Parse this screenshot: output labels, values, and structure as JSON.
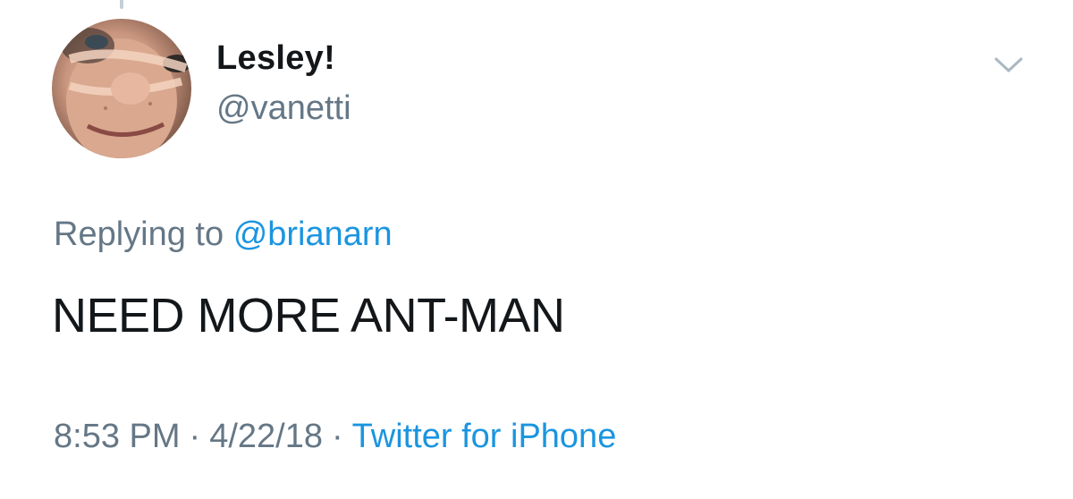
{
  "tweet": {
    "author": {
      "display_name": "Lesley!",
      "handle": "@vanetti"
    },
    "reply": {
      "prefix": "Replying to",
      "mention": "@brianarn"
    },
    "text": "NEED MORE ANT-MAN",
    "meta": {
      "time": "8:53 PM",
      "separator": "·",
      "date": "4/22/18",
      "source": "Twitter for iPhone"
    }
  },
  "icons": {
    "menu": "chevron-down-icon"
  },
  "colors": {
    "text_primary": "#14171a",
    "text_secondary": "#657786",
    "link": "#1b95e0",
    "chevron": "#aab8c2"
  }
}
